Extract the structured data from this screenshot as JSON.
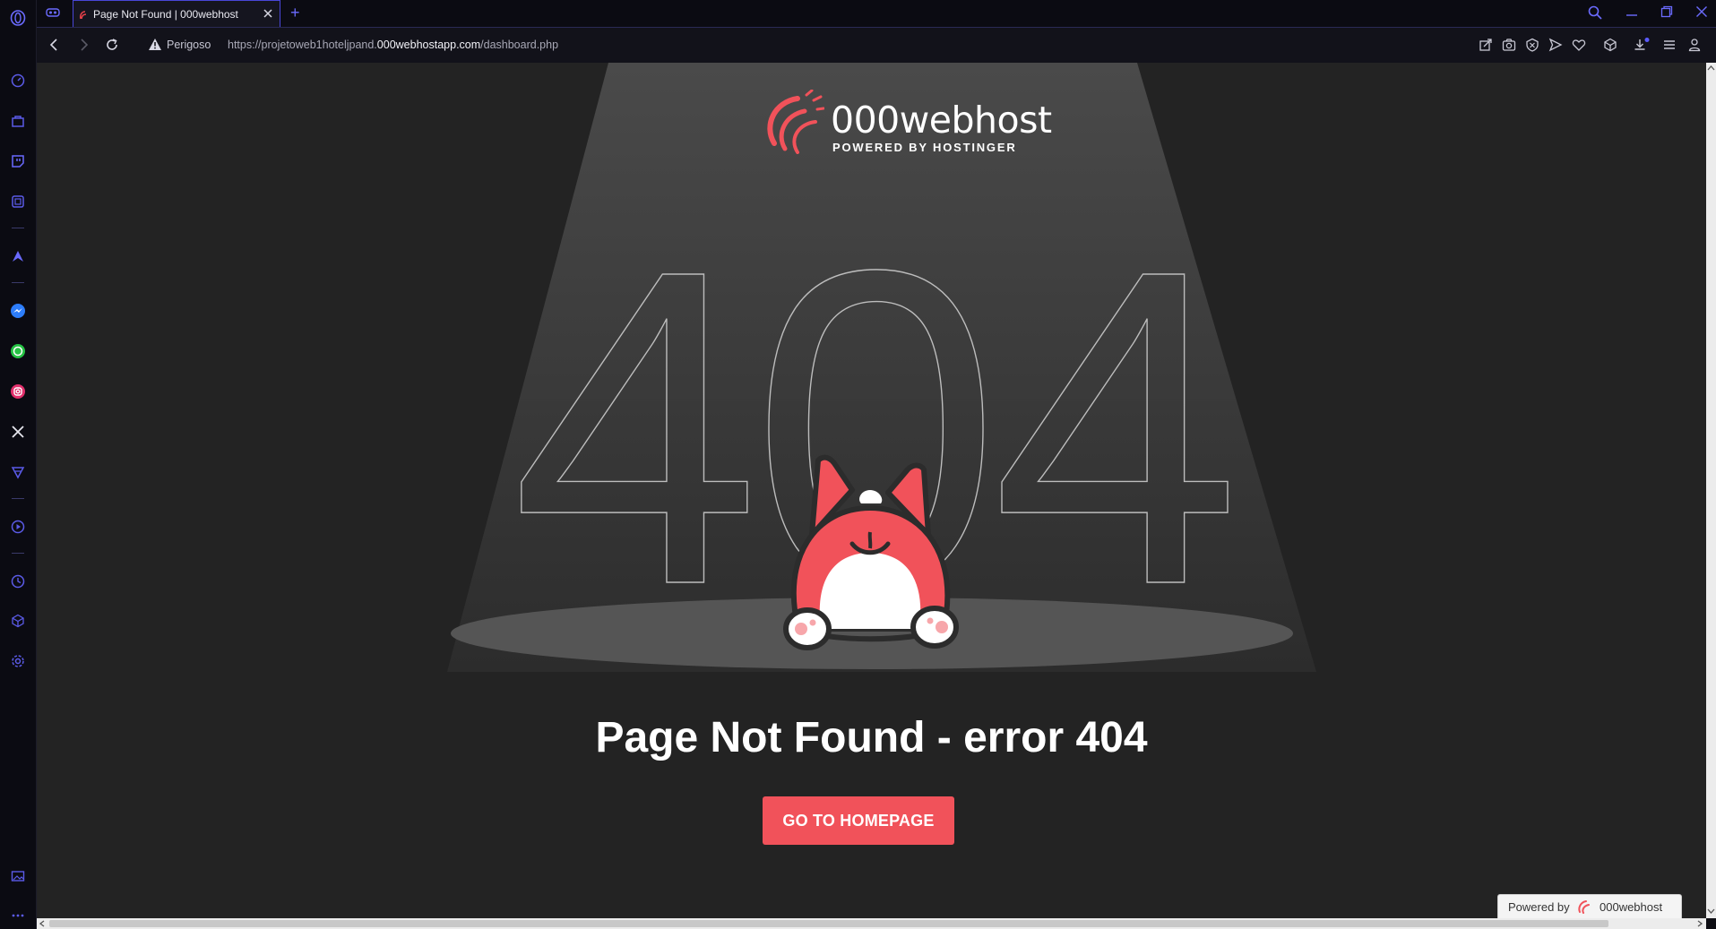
{
  "browser": {
    "tab_title": "Page Not Found | 000webhost",
    "new_tab_symbol": "+",
    "security_label": "Perigoso",
    "url_prefix": "https://projetoweb1hoteljpand.",
    "url_domain": "000webhostapp.com",
    "url_path": "/dashboard.php"
  },
  "sidebar": {
    "icons": [
      "opera-logo-icon",
      "speed-dial-icon",
      "shopping-bag-icon",
      "twitch-icon",
      "crypto-wallet-icon",
      "aria-icon",
      "messenger-icon",
      "whatsapp-icon",
      "instagram-icon",
      "x-icon",
      "vpn-icon",
      "player-icon",
      "history-icon",
      "extensions-icon",
      "settings-icon",
      "gallery-icon",
      "more-icon"
    ]
  },
  "toolbar_icons": [
    "snapshot-icon",
    "camera-icon",
    "adblock-icon",
    "send-icon",
    "heart-icon",
    "cube-icon",
    "download-icon",
    "easy-setup-icon",
    "profile-icon"
  ],
  "page": {
    "brand_name": "000webhost",
    "brand_tagline": "POWERED BY HOSTINGER",
    "big_number": "404",
    "heading": "Page Not Found - error 404",
    "button_label": "GO TO HOMEPAGE",
    "powered_by_label": "Powered by",
    "powered_by_brand": "000webhost"
  },
  "colors": {
    "accent": "#f1525a",
    "page_bg": "#232323",
    "browser_accent": "#4946d8"
  }
}
